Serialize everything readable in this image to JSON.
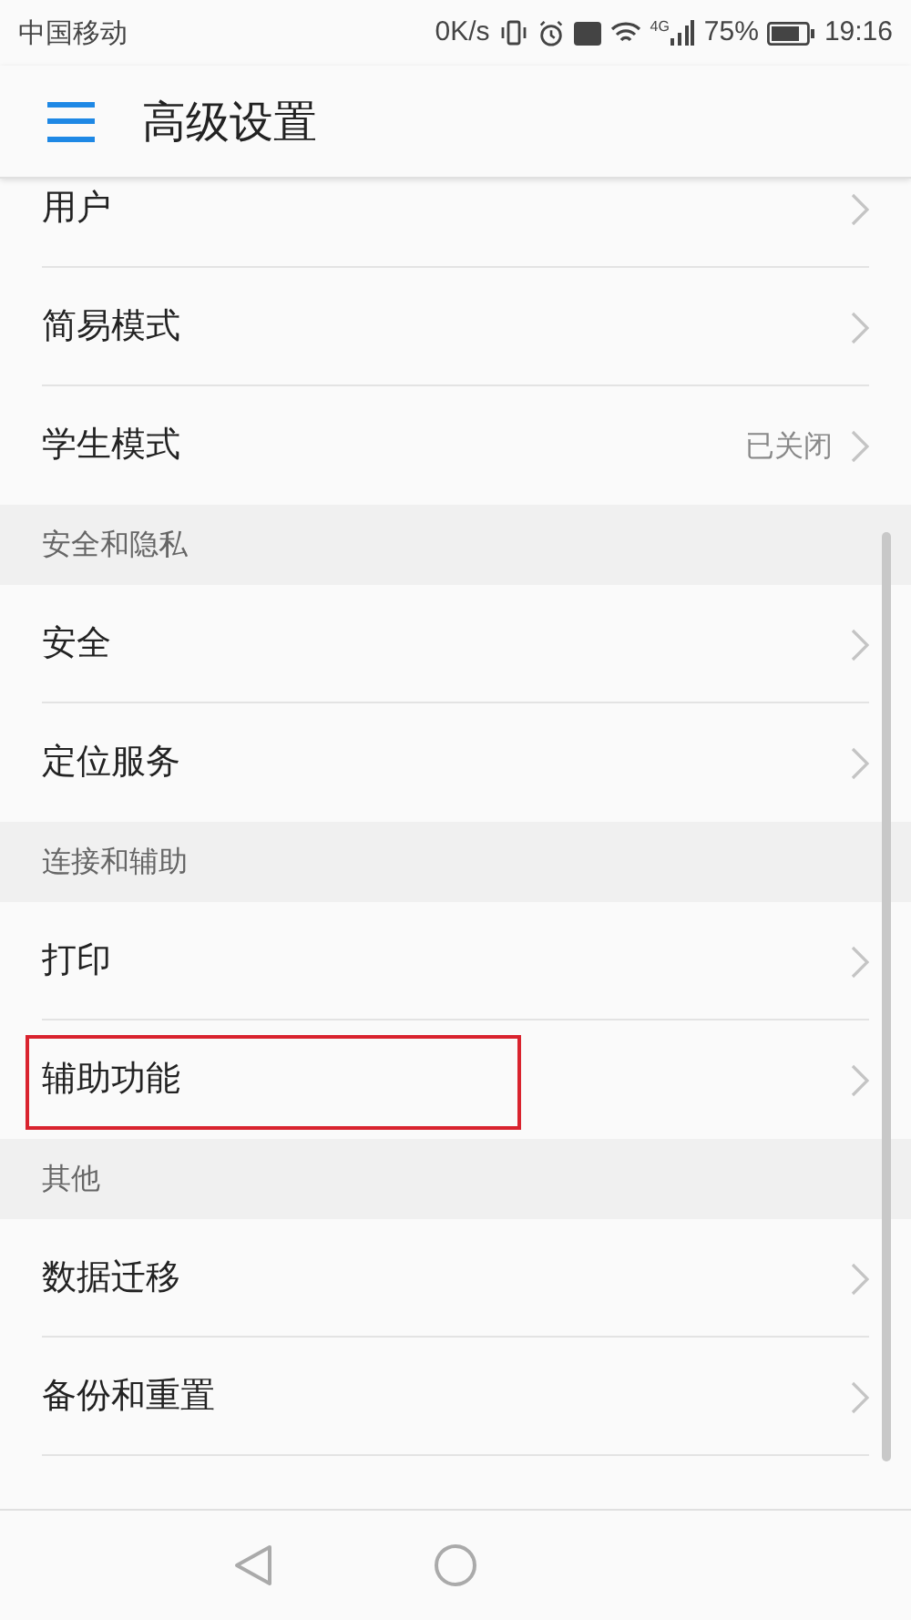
{
  "status_bar": {
    "carrier": "中国移动",
    "speed": "0K/s",
    "network": "4G",
    "battery": "75%",
    "time": "19:16"
  },
  "header": {
    "title": "高级设置"
  },
  "list": [
    {
      "kind": "item",
      "label": "用户",
      "highlighted": false
    },
    {
      "kind": "item",
      "label": "简易模式",
      "highlighted": false
    },
    {
      "kind": "item",
      "label": "学生模式",
      "value": "已关闭",
      "highlighted": false
    },
    {
      "kind": "header",
      "label": "安全和隐私"
    },
    {
      "kind": "item",
      "label": "安全",
      "highlighted": false
    },
    {
      "kind": "item",
      "label": "定位服务",
      "highlighted": false
    },
    {
      "kind": "header",
      "label": "连接和辅助"
    },
    {
      "kind": "item",
      "label": "打印",
      "highlighted": false
    },
    {
      "kind": "item",
      "label": "辅助功能",
      "highlighted": true
    },
    {
      "kind": "header",
      "label": "其他"
    },
    {
      "kind": "item",
      "label": "数据迁移",
      "highlighted": false
    },
    {
      "kind": "item",
      "label": "备份和重置",
      "highlighted": false
    }
  ]
}
